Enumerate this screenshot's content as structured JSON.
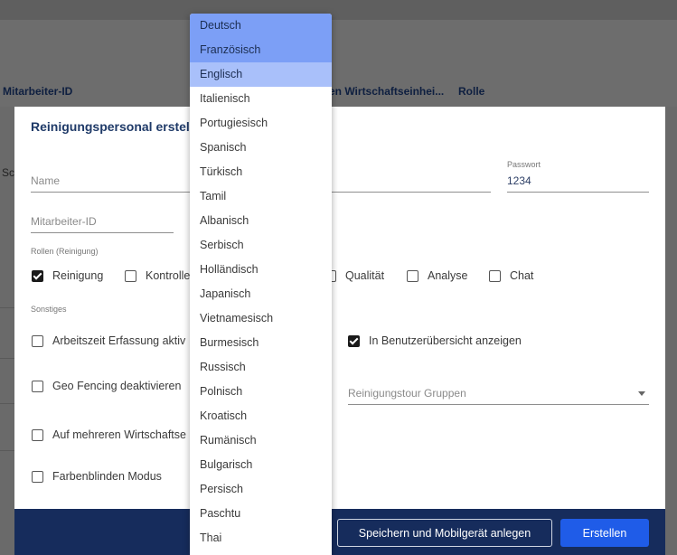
{
  "background": {
    "headers": [
      "Mitarbeiter-ID",
      "en Wirtschaftseinhei...",
      "Rolle"
    ],
    "left_text": "Sc"
  },
  "dialog": {
    "title": "Reinigungspersonal erstell",
    "fields": {
      "name": {
        "placeholder": "Name"
      },
      "password": {
        "label": "Passwort",
        "value": "1234"
      },
      "employee_id": {
        "placeholder": "Mitarbeiter-ID"
      }
    },
    "roles_label": "Rollen (Reinigung)",
    "roles": [
      {
        "label": "Reinigung",
        "checked": true
      },
      {
        "label": "Kontrolle",
        "checked": false
      },
      {
        "label": "Qualität",
        "checked": false
      },
      {
        "label": "Analyse",
        "checked": false
      },
      {
        "label": "Chat",
        "checked": false
      }
    ],
    "other_label": "Sonstiges",
    "options": {
      "time_tracking": {
        "label": "Arbeitszeit Erfassung aktiv",
        "checked": false
      },
      "user_overview": {
        "label": "In Benutzerübersicht anzeigen",
        "checked": true
      },
      "geo_fencing": {
        "label": "Geo Fencing deaktivieren",
        "checked": false
      },
      "multi_units": {
        "label": "Auf mehreren Wirtschaftse",
        "checked": false
      },
      "colorblind": {
        "label": "Farbenblinden Modus",
        "checked": false
      }
    },
    "tour_groups": {
      "placeholder": "Reinigungstour Gruppen"
    },
    "buttons": {
      "save_mobile": "Speichern und Mobilgerät anlegen",
      "create": "Erstellen"
    }
  },
  "language_dropdown": {
    "selected": [
      "Deutsch",
      "Französisch"
    ],
    "highlighted": "Englisch",
    "options": [
      "Deutsch",
      "Französisch",
      "Englisch",
      "Italienisch",
      "Portugiesisch",
      "Spanisch",
      "Türkisch",
      "Tamil",
      "Albanisch",
      "Serbisch",
      "Holländisch",
      "Japanisch",
      "Vietnamesisch",
      "Burmesisch",
      "Russisch",
      "Polnisch",
      "Kroatisch",
      "Rumänisch",
      "Bulgarisch",
      "Persisch",
      "Paschtu",
      "Thai"
    ]
  },
  "colors": {
    "primary": "#1f5ce8",
    "footer": "#162c5c",
    "selected_option": "#7c9ff6",
    "highlighted_option": "#a9c0fa"
  }
}
